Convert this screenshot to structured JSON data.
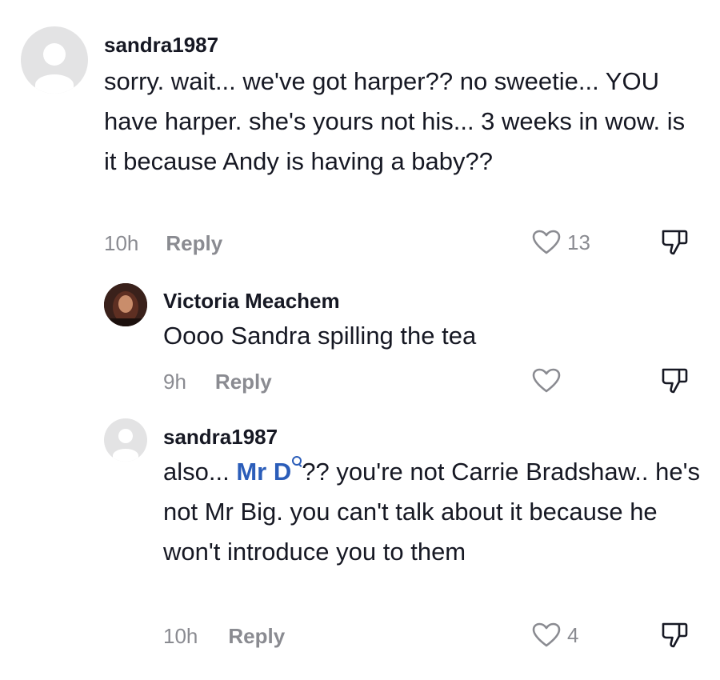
{
  "comments": [
    {
      "username": "sandra1987",
      "text": "sorry. wait... we've got harper?? no sweetie... YOU have harper. she's yours not his... 3 weeks in wow. is it because Andy is having a baby??",
      "time": "10h",
      "reply_label": "Reply",
      "likes": "13",
      "avatar": "default-avatar"
    },
    {
      "username": "Victoria Meachem",
      "text": "Oooo Sandra spilling the tea",
      "time": "9h",
      "reply_label": "Reply",
      "likes": "",
      "avatar": "profile-photo"
    },
    {
      "username": "sandra1987",
      "text_before": "also... ",
      "mention": "Mr D",
      "text_after": "?? you're not Carrie Bradshaw.. he's not Mr Big. you can't talk about it because he won't introduce you to them",
      "time": "10h",
      "reply_label": "Reply",
      "likes": "4",
      "avatar": "default-avatar"
    }
  ],
  "icons": {
    "like": "heart-outline-icon",
    "dislike": "thumbs-down-icon",
    "mention_search": "search-icon"
  },
  "colors": {
    "text": "#161823",
    "secondary": "#8a8b91",
    "mention": "#2b5db9",
    "avatar_bg": "#e3e3e4"
  }
}
